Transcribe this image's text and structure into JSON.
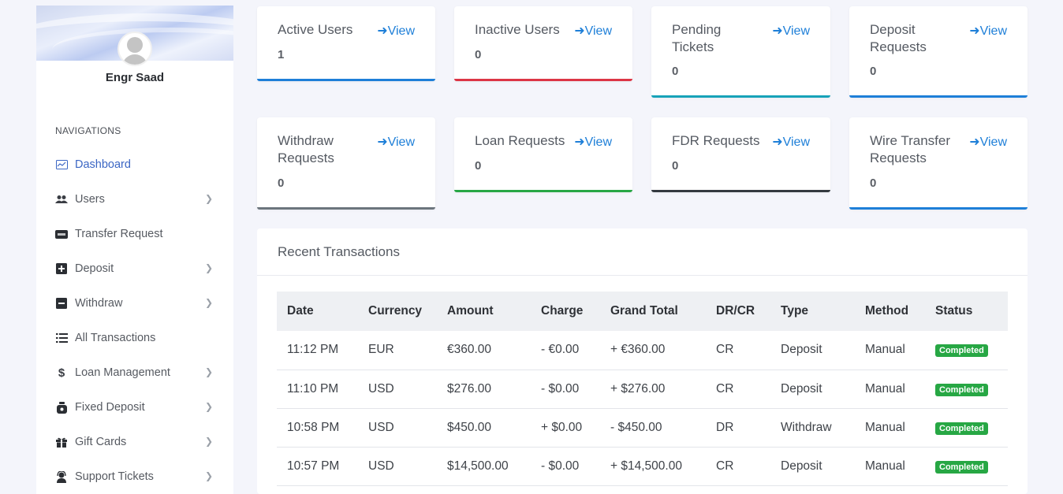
{
  "sidebar": {
    "profile_name": "Engr Saad",
    "nav_heading": "NAVIGATIONS",
    "items": [
      {
        "label": "Dashboard",
        "icon": "dashboard-icon",
        "has_chevron": false,
        "active": true
      },
      {
        "label": "Users",
        "icon": "users-icon",
        "has_chevron": true
      },
      {
        "label": "Transfer Request",
        "icon": "transfer-icon",
        "has_chevron": false
      },
      {
        "label": "Deposit",
        "icon": "plus-square-icon",
        "has_chevron": true
      },
      {
        "label": "Withdraw",
        "icon": "minus-square-icon",
        "has_chevron": true
      },
      {
        "label": "All Transactions",
        "icon": "list-icon",
        "has_chevron": false
      },
      {
        "label": "Loan Management",
        "icon": "dollar-icon",
        "has_chevron": true
      },
      {
        "label": "Fixed Deposit",
        "icon": "piggy-bank-icon",
        "has_chevron": true
      },
      {
        "label": "Gift Cards",
        "icon": "gift-icon",
        "has_chevron": true
      },
      {
        "label": "Support Tickets",
        "icon": "support-icon",
        "has_chevron": true
      }
    ]
  },
  "cards": [
    {
      "title": "Active Users",
      "view": "View",
      "value": "1",
      "color": "#1e7fd8"
    },
    {
      "title": "Inactive Users",
      "view": "View",
      "value": "0",
      "color": "#dc3545"
    },
    {
      "title": "Pending Tickets",
      "view": "View",
      "value": "0",
      "color": "#17a2b8"
    },
    {
      "title": "Deposit Requests",
      "view": "View",
      "value": "0",
      "color": "#1e7fd8"
    },
    {
      "title": "Withdraw Requests",
      "view": "View",
      "value": "0",
      "color": "#6c757d"
    },
    {
      "title": "Loan Requests",
      "view": "View",
      "value": "0",
      "color": "#28a745"
    },
    {
      "title": "FDR Requests",
      "view": "View",
      "value": "0",
      "color": "#343a40"
    },
    {
      "title": "Wire Transfer Requests",
      "view": "View",
      "value": "0",
      "color": "#1e7fd8"
    }
  ],
  "transactions": {
    "title": "Recent Transactions",
    "columns": [
      "Date",
      "Currency",
      "Amount",
      "Charge",
      "Grand Total",
      "DR/CR",
      "Type",
      "Method",
      "Status"
    ],
    "rows": [
      {
        "date": "11:12 PM",
        "currency": "EUR",
        "amount": "€360.00",
        "charge": "- €0.00",
        "grand_total": "+ €360.00",
        "total_sign": "pos",
        "drcr": "CR",
        "type": "Deposit",
        "method": "Manual",
        "status": "Completed"
      },
      {
        "date": "11:10 PM",
        "currency": "USD",
        "amount": "$276.00",
        "charge": "- $0.00",
        "grand_total": "+ $276.00",
        "total_sign": "pos",
        "drcr": "CR",
        "type": "Deposit",
        "method": "Manual",
        "status": "Completed"
      },
      {
        "date": "10:58 PM",
        "currency": "USD",
        "amount": "$450.00",
        "charge": "+ $0.00",
        "grand_total": "- $450.00",
        "total_sign": "neg",
        "drcr": "DR",
        "type": "Withdraw",
        "method": "Manual",
        "status": "Completed"
      },
      {
        "date": "10:57 PM",
        "currency": "USD",
        "amount": "$14,500.00",
        "charge": "- $0.00",
        "grand_total": "+ $14,500.00",
        "total_sign": "pos",
        "drcr": "CR",
        "type": "Deposit",
        "method": "Manual",
        "status": "Completed"
      }
    ]
  }
}
